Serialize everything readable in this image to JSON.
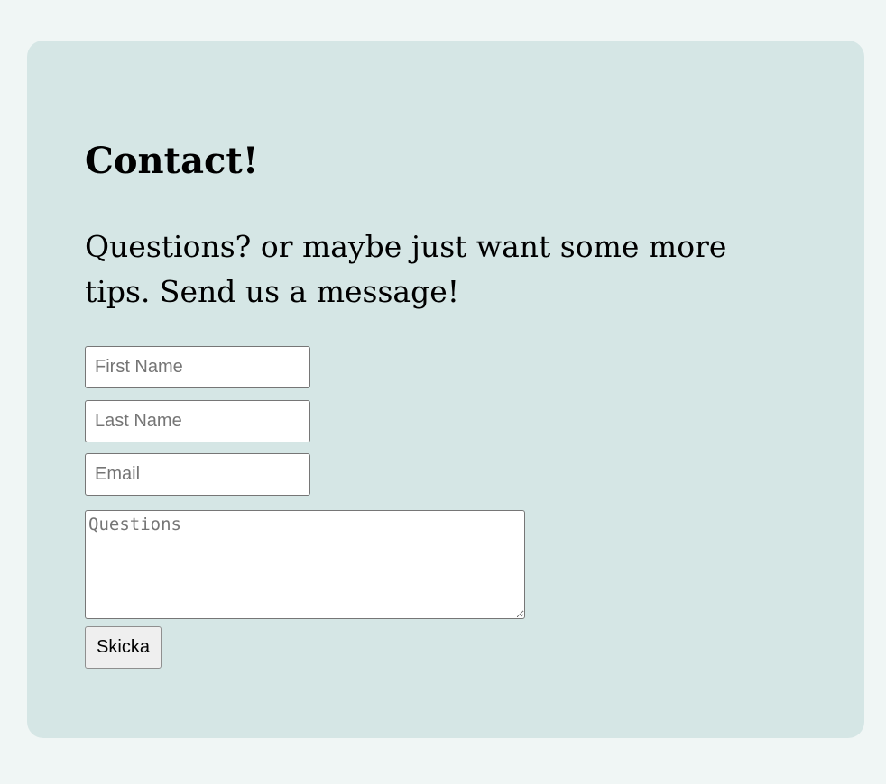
{
  "contact": {
    "title": "Contact!",
    "subtitle": "Questions? or maybe just want some more tips. Send us a message!",
    "first_name_placeholder": "First Name",
    "last_name_placeholder": "Last Name",
    "email_placeholder": "Email",
    "questions_placeholder": "Questions",
    "submit_label": "Skicka"
  },
  "colors": {
    "page_background": "#f0f6f5",
    "card_background": "#d5e6e5"
  }
}
